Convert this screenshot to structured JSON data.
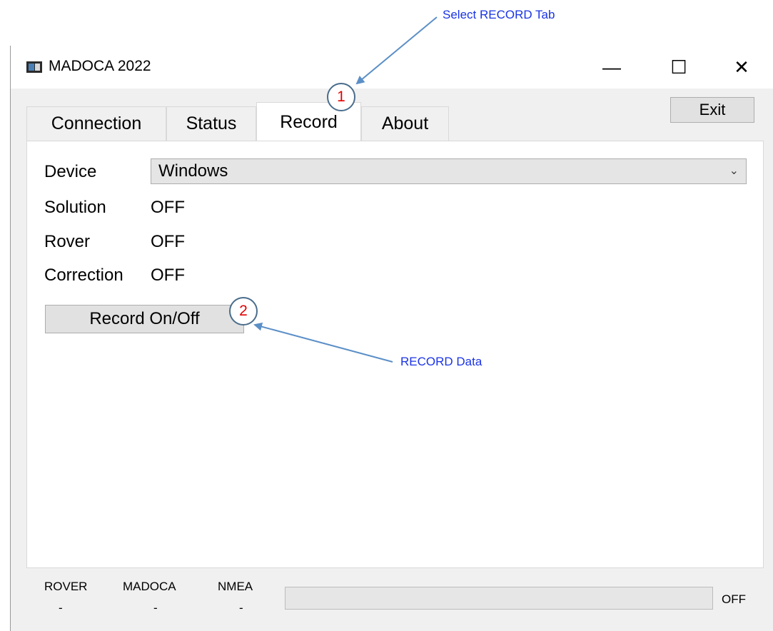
{
  "annotations": {
    "select_tab_note": "Select RECORD Tab",
    "record_data_note": "RECORD Data",
    "marker_1": "1",
    "marker_2": "2"
  },
  "window": {
    "title": "MADOCA 2022",
    "controls": {
      "minimize": "—",
      "maximize": "☐",
      "close": "✕"
    }
  },
  "tabs": [
    {
      "label": "Connection",
      "active": false
    },
    {
      "label": "Status",
      "active": false
    },
    {
      "label": "Record",
      "active": true
    },
    {
      "label": "About",
      "active": false
    }
  ],
  "exit_label": "Exit",
  "record_panel": {
    "device_label": "Device",
    "device_value": "Windows",
    "solution_label": "Solution",
    "solution_value": "OFF",
    "rover_label": "Rover",
    "rover_value": "OFF",
    "correction_label": "Correction",
    "correction_value": "OFF",
    "record_button": "Record On/Off"
  },
  "status_bar": {
    "rover_label": "ROVER",
    "rover_value": "-",
    "madoca_label": "MADOCA",
    "madoca_value": "-",
    "nmea_label": "NMEA",
    "nmea_value": "-",
    "progress": 0,
    "state": "OFF"
  },
  "colors": {
    "annotation_text": "#1a33e6",
    "marker_number": "#e00000",
    "arrow": "#5b8fc7"
  }
}
